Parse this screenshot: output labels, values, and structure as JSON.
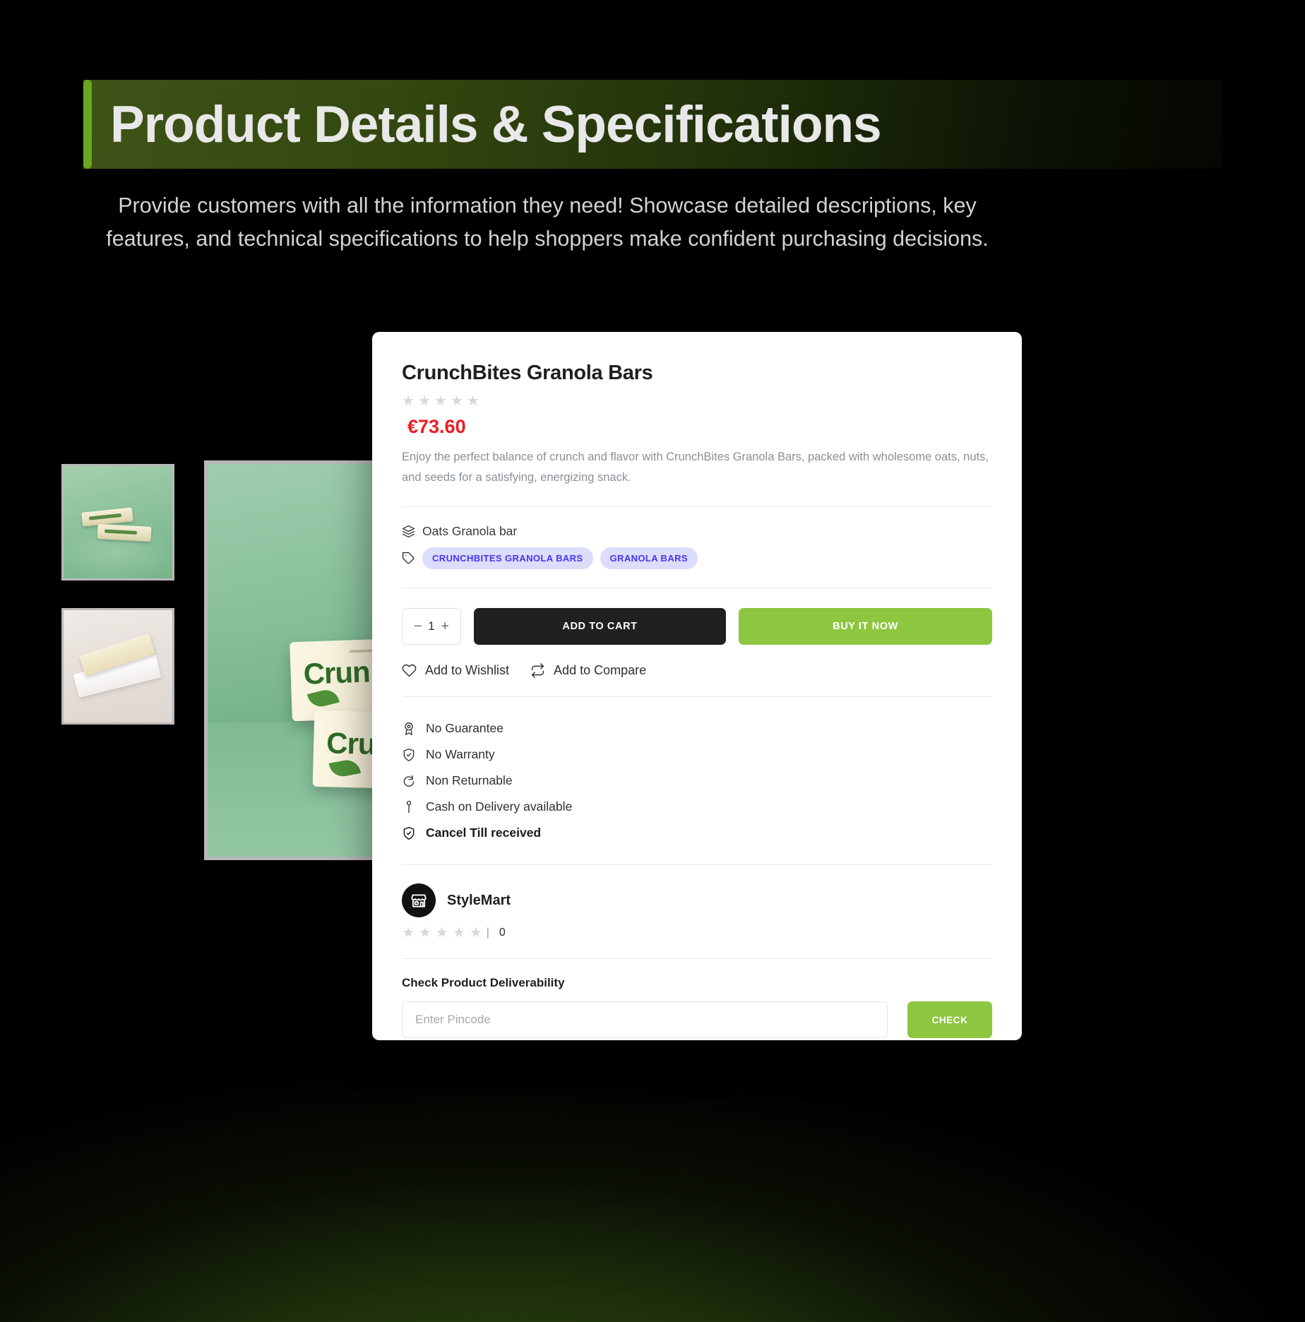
{
  "header": {
    "title": "Product Details & Specifications",
    "subtitle": "Provide customers with all the information they need! Showcase detailed descriptions, key features, and technical specifications to help shoppers make confident purchasing decisions.",
    "accent_color": "#69a722"
  },
  "gallery": {
    "thumbnails": [
      {
        "name": "granola-bars-on-green-background"
      },
      {
        "name": "granola-bar-unwrapped"
      }
    ],
    "main_image": {
      "name": "crunchbites-packs-on-green-background",
      "pack_label": "Crun"
    }
  },
  "product": {
    "title": "CrunchBites Granola Bars",
    "rating": 0,
    "stars_total": 5,
    "price": "€73.60",
    "price_color": "#ec1c24",
    "description": "Enjoy the perfect balance of crunch and flavor with CrunchBites Granola Bars, packed with wholesome oats, nuts, and seeds for a satisfying, energizing snack.",
    "category": "Oats Granola bar",
    "tags": [
      "CRUNCHBITES GRANOLA BARS",
      "GRANOLA BARS"
    ],
    "tag_color": "#4338f0",
    "tag_background": "#dcdcfb"
  },
  "purchase": {
    "quantity": "1",
    "decrement_label": "−",
    "increment_label": "+",
    "add_to_cart_label": "ADD TO CART",
    "buy_now_label": "BUY IT NOW",
    "cart_color": "#221f1f",
    "buy_color": "#8dc63f"
  },
  "secondary_actions": {
    "wishlist_label": "Add to Wishlist",
    "compare_label": "Add to Compare"
  },
  "policies": [
    {
      "label": "No Guarantee",
      "icon": "award-icon",
      "bold": false
    },
    {
      "label": "No Warranty",
      "icon": "shield-check-icon",
      "bold": false
    },
    {
      "label": "Non Returnable",
      "icon": "rotate-icon",
      "bold": false
    },
    {
      "label": "Cash on Delivery available",
      "icon": "pin-icon",
      "bold": false
    },
    {
      "label": "Cancel Till received",
      "icon": "shield-check-icon",
      "bold": true
    }
  ],
  "seller": {
    "name": "StyleMart",
    "icon": "store-icon",
    "rating": 0,
    "stars_total": 5,
    "separator": "|",
    "review_count": "0"
  },
  "deliverability": {
    "title": "Check Product Deliverability",
    "pincode_value": "",
    "pincode_placeholder": "Enter Pincode",
    "check_label": "CHECK",
    "check_color": "#8dc63f"
  }
}
